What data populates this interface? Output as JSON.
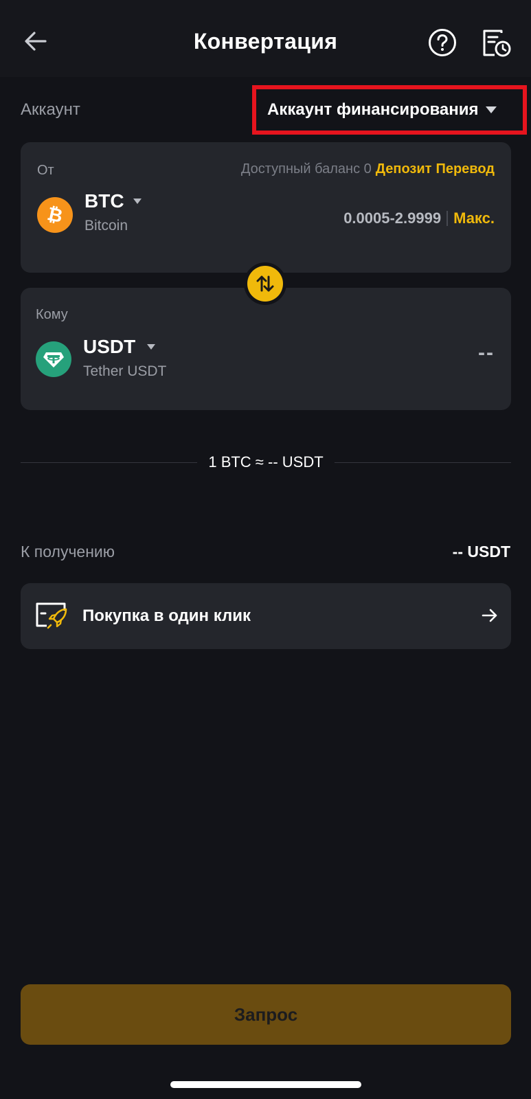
{
  "header": {
    "title": "Конвертация",
    "back_icon": "arrow-left-icon",
    "help_icon": "question-circle-icon",
    "history_icon": "order-history-icon"
  },
  "account": {
    "label": "Аккаунт",
    "selected": "Аккаунт финансирования"
  },
  "from": {
    "label": "От",
    "balance_text": "Доступный баланс 0",
    "deposit_label": "Депозит",
    "transfer_label": "Перевод",
    "coin_symbol": "BTC",
    "coin_name": "Bitcoin",
    "range": "0.0005-2.9999",
    "max_label": "Макс."
  },
  "to": {
    "label": "Кому",
    "coin_symbol": "USDT",
    "coin_name": "Tether USDT",
    "amount": "--"
  },
  "rate": "1 BTC ≈ -- USDT",
  "receive": {
    "label": "К получению",
    "value": "-- USDT"
  },
  "one_click": {
    "label": "Покупка в один клик"
  },
  "submit": {
    "label": "Запрос"
  },
  "colors": {
    "accent": "#f0b90b",
    "background": "#121318",
    "card": "#24262c",
    "highlight_box": "#e6141e",
    "submit_disabled": "#6a4c10"
  }
}
